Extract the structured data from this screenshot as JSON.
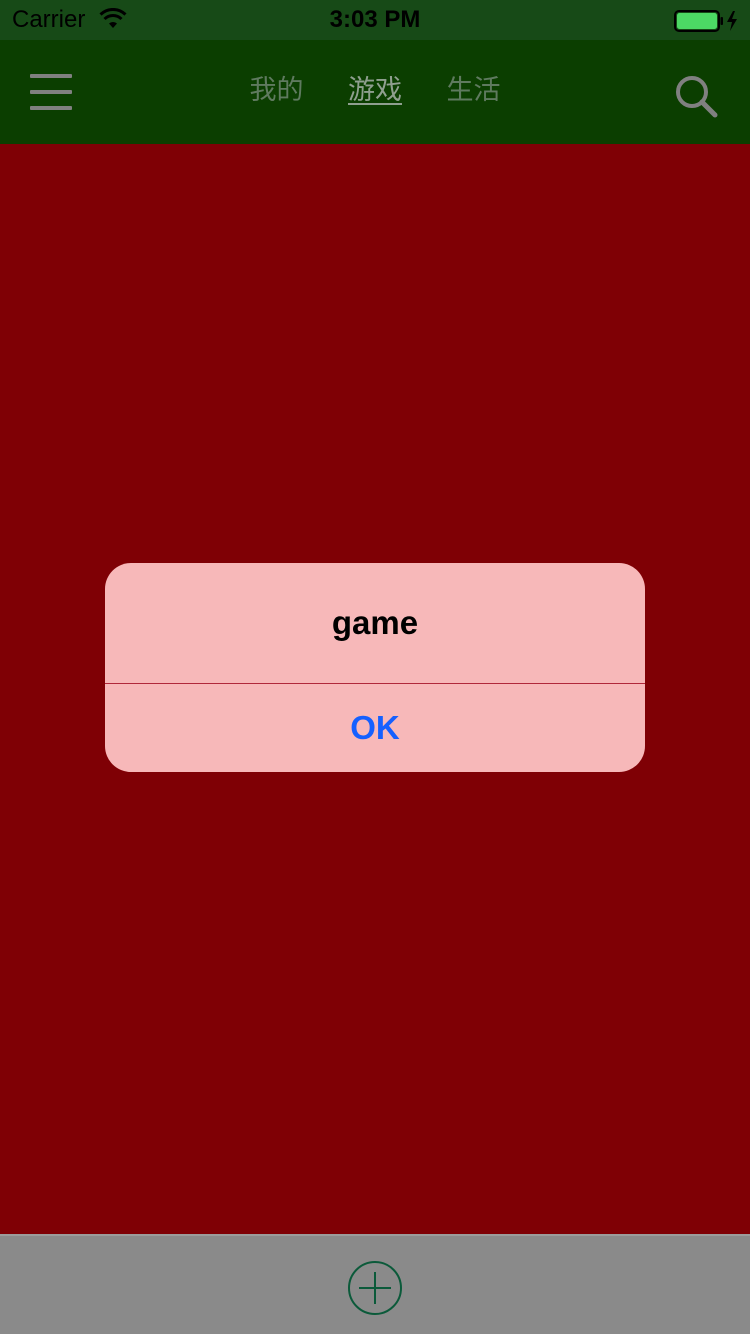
{
  "status_bar": {
    "carrier": "Carrier",
    "time": "3:03 PM",
    "wifi_icon": "wifi-icon",
    "battery_icon": "battery-charging-icon",
    "battery_color": "#4cd964"
  },
  "nav": {
    "menu_icon": "hamburger-menu-icon",
    "tabs": [
      {
        "label": "我的",
        "active": false
      },
      {
        "label": "游戏",
        "active": true
      },
      {
        "label": "生活",
        "active": false
      }
    ],
    "search_icon": "search-icon",
    "background": "#0b3e00"
  },
  "content": {
    "background": "#7f0005"
  },
  "alert": {
    "title": "game",
    "ok_label": "OK",
    "background": "#f7b8b9",
    "button_color": "#1560ff"
  },
  "bottom_bar": {
    "add_icon": "plus-circle-icon",
    "background": "#8a8a8a"
  }
}
